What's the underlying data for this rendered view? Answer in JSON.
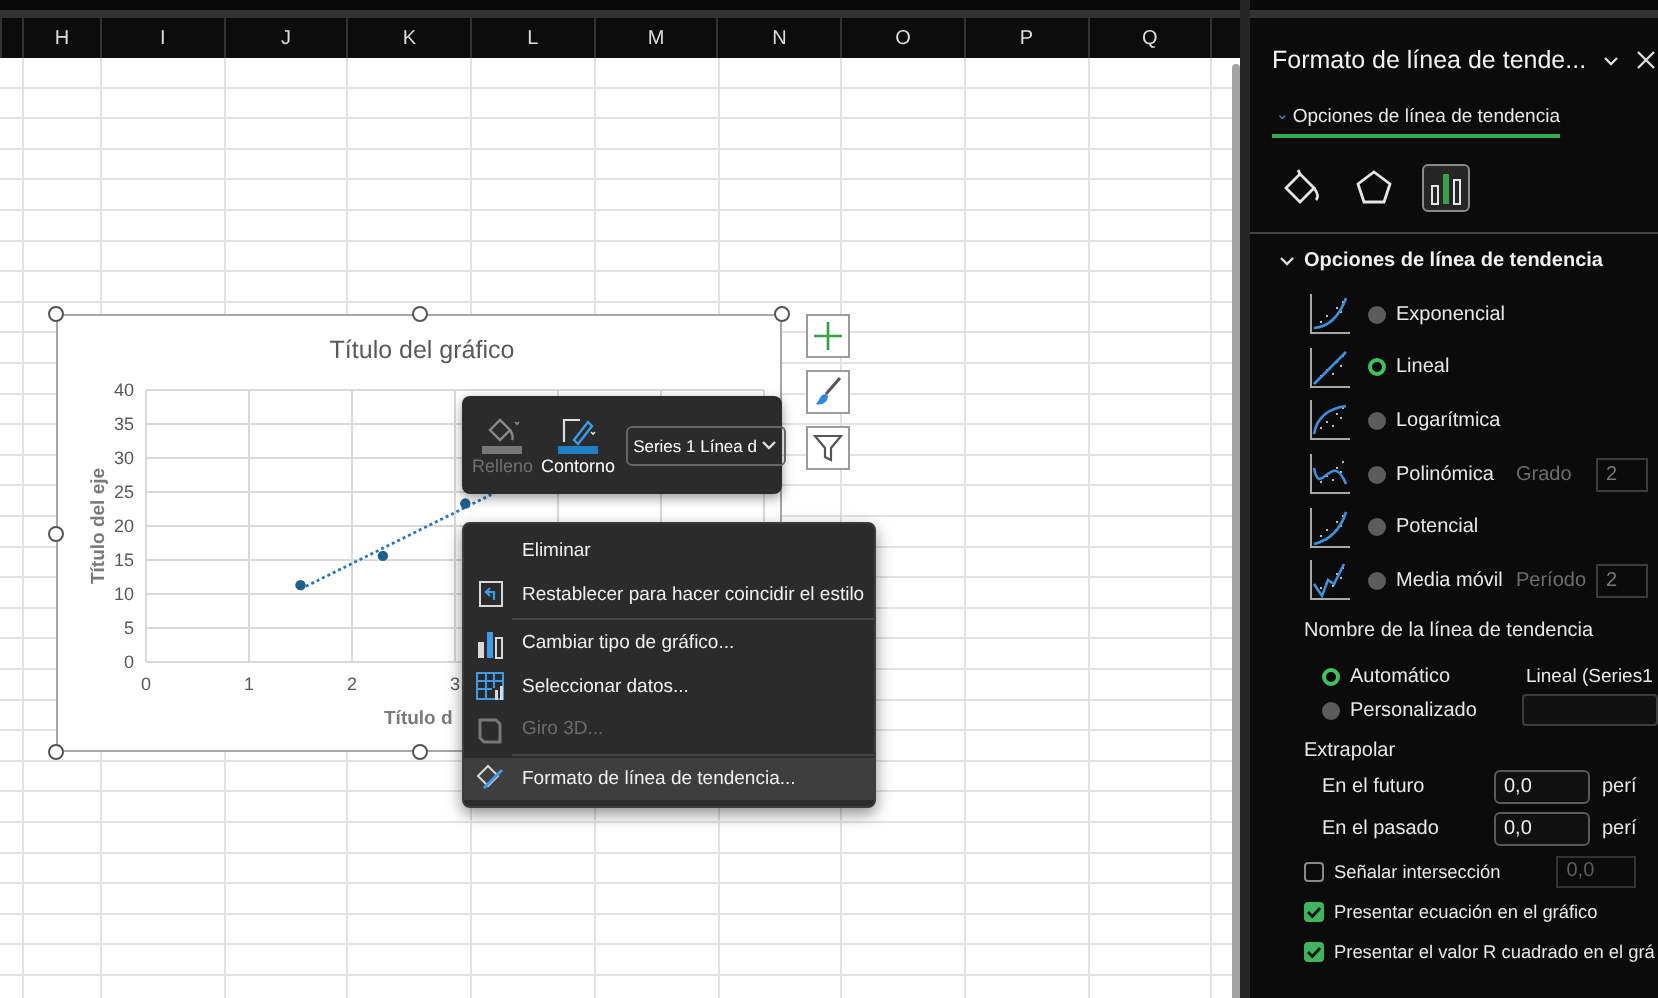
{
  "sheet": {
    "columns": [
      "H",
      "I",
      "J",
      "K",
      "L",
      "M",
      "N",
      "O",
      "P",
      "Q"
    ]
  },
  "chart": {
    "chart_data": {
      "type": "scatter",
      "title": "Título del gráfico",
      "xlabel": "Título d",
      "ylabel": "Título del eje",
      "x": [
        1.5,
        2.3,
        3.1
      ],
      "series": [
        {
          "color": "#1f5f8b",
          "values": [
            11.3,
            15.6,
            23.3
          ]
        }
      ],
      "grid": true,
      "xlim": [
        0,
        6
      ],
      "ylim": [
        0,
        40
      ],
      "xticks": [
        0,
        1,
        2,
        3
      ],
      "yticks": [
        0,
        5,
        10,
        15,
        20,
        25,
        30,
        35,
        40
      ]
    },
    "trendline": {
      "kind": "linear"
    }
  },
  "mini_toolbar": {
    "buttons": [
      {
        "kind": "fill",
        "label": "Relleno",
        "disabled": true
      },
      {
        "kind": "outline",
        "label": "Contorno",
        "disabled": false
      }
    ],
    "dropdown": "Series 1 Línea d"
  },
  "context_menu": {
    "groups": [
      [
        {
          "kind": "plain",
          "label": "Eliminar",
          "disabled": false,
          "highlighted": false
        },
        {
          "kind": "reset",
          "label": "Restablecer para hacer coincidir el estilo",
          "disabled": false,
          "highlighted": false
        }
      ],
      [
        {
          "kind": "chart_type",
          "label": "Cambiar tipo de gráfico...",
          "disabled": false,
          "highlighted": false
        },
        {
          "kind": "select_data",
          "label": "Seleccionar datos...",
          "disabled": false,
          "highlighted": false
        },
        {
          "kind": "rotate",
          "label": "Giro 3D...",
          "disabled": true,
          "highlighted": false
        }
      ],
      [
        {
          "kind": "format",
          "label": "Formato de línea de tendencia...",
          "disabled": false,
          "highlighted": true
        }
      ]
    ]
  },
  "panel": {
    "title": "Formato de línea de tende...",
    "subtitle": "Opciones de línea de tendencia",
    "tab_icons": [
      {
        "kind": "fill",
        "selected": false
      },
      {
        "kind": "effects",
        "selected": false
      },
      {
        "kind": "options",
        "selected": true
      }
    ],
    "section": {
      "title": "Opciones de línea de tendencia",
      "expanded": true
    },
    "trend_types": [
      {
        "kind": "exponential",
        "label": "Exponencial",
        "selected": false
      },
      {
        "kind": "linear",
        "label": "Lineal",
        "selected": true
      },
      {
        "kind": "logarithmic",
        "label": "Logarítmica",
        "selected": false
      },
      {
        "kind": "polynomial",
        "label": "Polinómica",
        "selected": false,
        "param": {
          "label": "Grado",
          "value": "2",
          "disabled": true
        }
      },
      {
        "kind": "power",
        "label": "Potencial",
        "selected": false
      },
      {
        "kind": "moving_average",
        "label": "Media móvil",
        "selected": false,
        "param": {
          "label": "Período",
          "value": "2",
          "disabled": true
        }
      }
    ],
    "name_label": "Nombre de la línea de tendencia",
    "name_options": [
      {
        "kind": "text",
        "label": "Automático",
        "selected": true,
        "value": "Lineal (Series1"
      },
      {
        "kind": "input",
        "label": "Personalizado",
        "selected": false
      }
    ],
    "extrapolate": {
      "title": "Extrapolar",
      "rows": [
        {
          "label": "En el futuro",
          "value": "0,0",
          "unit": "perí"
        },
        {
          "label": "En el pasado",
          "value": "0,0",
          "unit": "perí"
        }
      ]
    },
    "checkboxes": [
      {
        "label": "Señalar intersección",
        "checked": false,
        "value": "0,0",
        "value_disabled": true
      },
      {
        "label": "Presentar ecuación en el gráfico",
        "checked": true
      },
      {
        "label": "Presentar el valor R cuadrado en el grá",
        "checked": true
      }
    ]
  }
}
